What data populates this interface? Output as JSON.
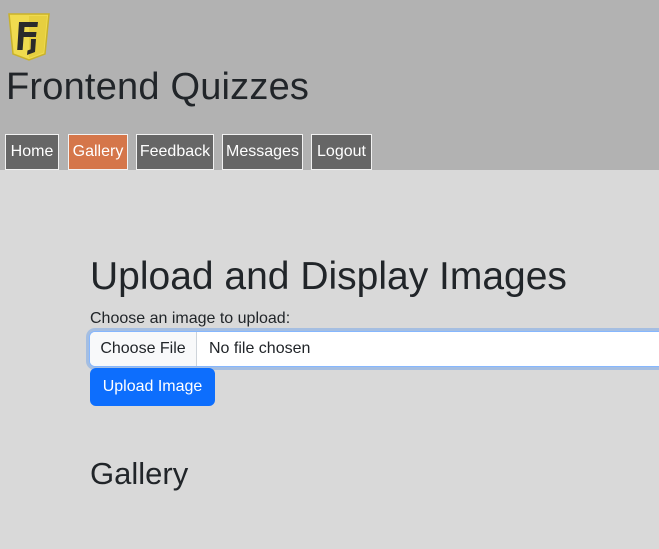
{
  "header": {
    "logo_icon": "frontend-quizzes-logo-icon",
    "logo_colors": {
      "shield": "#f0db4f",
      "shield_edge": "#c9b22a",
      "glyph": "#2b2b2b"
    },
    "title": "Frontend Quizzes",
    "background": "#b2b2b2"
  },
  "nav": {
    "items": [
      {
        "label": "Home",
        "active": false
      },
      {
        "label": "Gallery",
        "active": true
      },
      {
        "label": "Feedback",
        "active": false
      },
      {
        "label": "Messages",
        "active": false
      },
      {
        "label": "Logout",
        "active": false
      }
    ],
    "colors": {
      "default": "#666666",
      "active": "#d5764a",
      "text": "#ffffff"
    }
  },
  "main": {
    "page_title": "Upload and Display Images",
    "upload_label": "Choose an image to upload:",
    "file_input": {
      "button_label": "Choose File",
      "status": "No file chosen"
    },
    "upload_button_label": "Upload Image",
    "gallery_title": "Gallery",
    "colors": {
      "background": "#d9d9d9",
      "primary": "#0d6efd"
    }
  }
}
